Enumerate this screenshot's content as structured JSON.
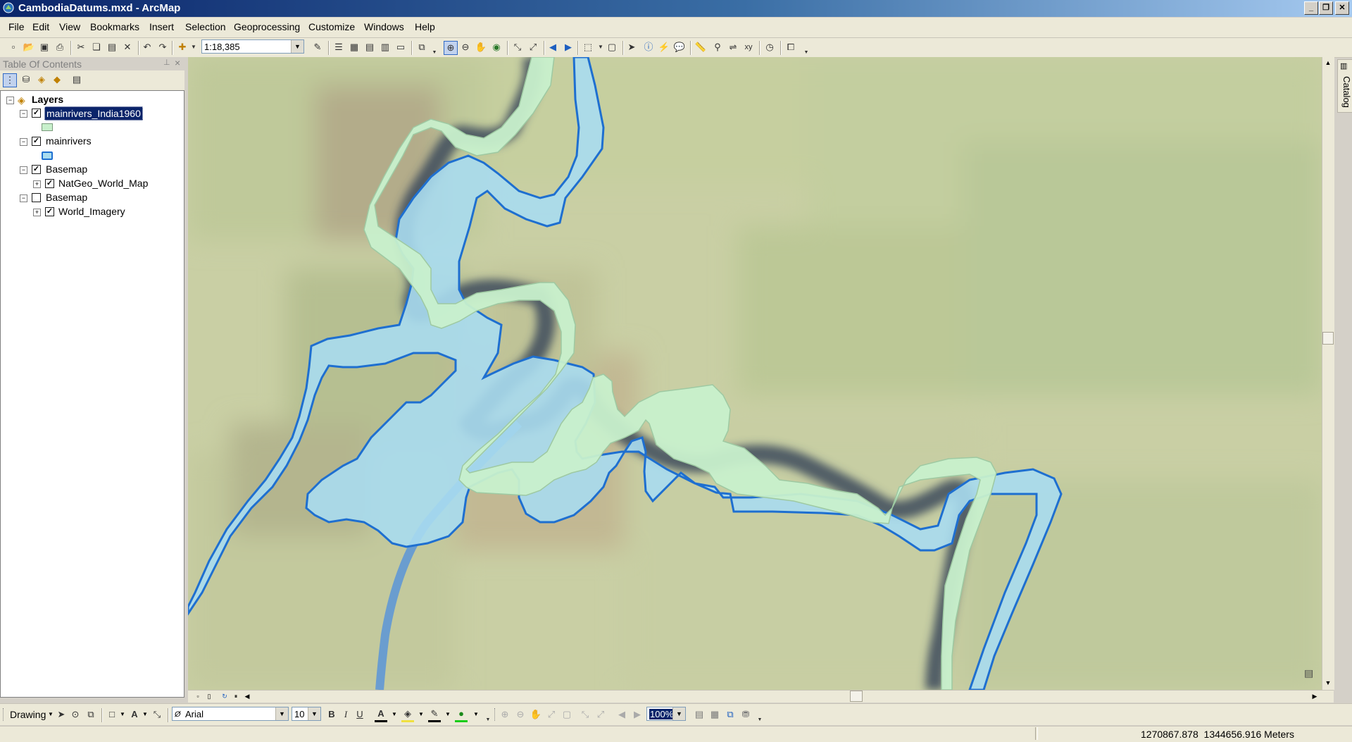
{
  "window": {
    "title": "CambodiaDatums.mxd - ArcMap",
    "minimize_glyph": "_",
    "restore_glyph": "❐",
    "close_glyph": "✕"
  },
  "menu": [
    "File",
    "Edit",
    "View",
    "Bookmarks",
    "Insert",
    "Selection",
    "Geoprocessing",
    "Customize",
    "Windows",
    "Help"
  ],
  "standard_toolbar": {
    "scale_value": "1:18,385"
  },
  "toc": {
    "title": "Table Of Contents",
    "pin_glyph": "⊥",
    "close_glyph": "×",
    "root": "Layers",
    "layers": [
      {
        "name": "mainrivers_India1960",
        "checked": true,
        "selected": true,
        "swatch_fill": "#c8f0cc",
        "swatch_stroke": "#7a9a7c"
      },
      {
        "name": "mainrivers",
        "checked": true,
        "swatch_fill": "#a9dcef",
        "swatch_stroke": "#1e6fd0"
      },
      {
        "name": "Basemap",
        "checked": true,
        "sublayer": "NatGeo_World_Map"
      },
      {
        "name": "Basemap",
        "checked": false,
        "sublayer": "World_Imagery"
      }
    ]
  },
  "map": {
    "river_1960_fill": "#c8f0cc",
    "river_1960_stroke": "#9ec9a2",
    "river_fill": "#a9dcef",
    "river_stroke": "#1e6fd0",
    "shadow_color": "#3d4a5c",
    "terrain_base": "#c9cfa4"
  },
  "catalog_tab": "Catalog",
  "drawing_toolbar": {
    "drawing_label": "Drawing",
    "font_name": "Arial",
    "font_size": "10",
    "bold": "B",
    "italic": "I",
    "underline": "U",
    "zoom_value": "100%"
  },
  "status": {
    "coordinates": "1270867.878  1344656.916 Meters"
  }
}
